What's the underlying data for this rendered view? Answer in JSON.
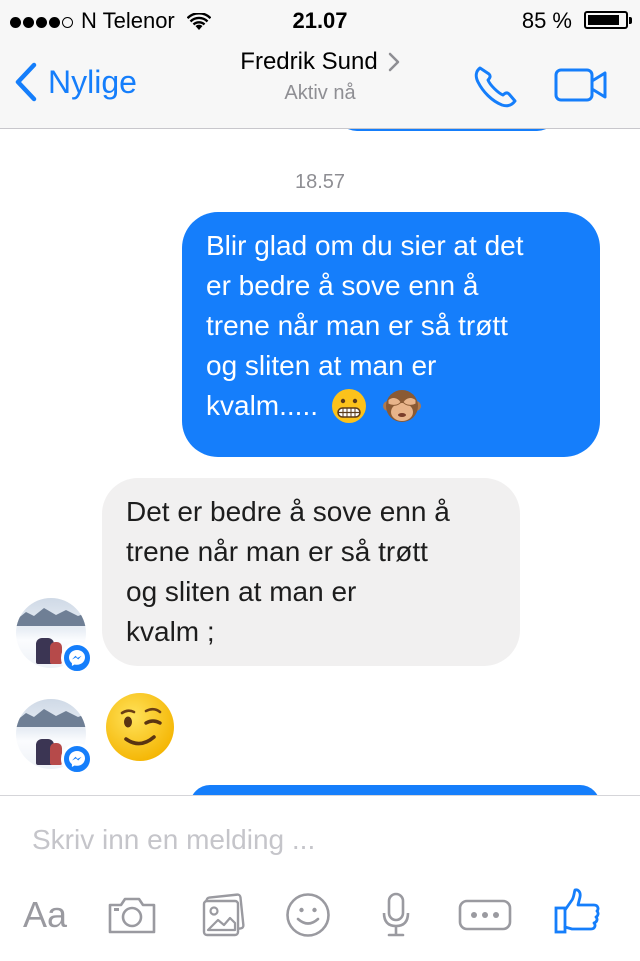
{
  "status_bar": {
    "carrier": "N Telenor",
    "time": "21.07",
    "battery_percent": "85 %",
    "signal_bars": 4,
    "battery_level": 0.85
  },
  "navbar": {
    "back_label": "Nylige",
    "contact_name": "Fredrik Sund",
    "status": "Aktiv nå",
    "back_icon": "chevron-left-icon",
    "phone_icon": "phone-icon",
    "video_icon": "video-camera-icon"
  },
  "conversation": {
    "timestamp": "18.57",
    "messages": [
      {
        "direction": "outgoing",
        "lines": [
          "Blir glad om du sier at det",
          "er bedre å sove enn å",
          "trene når man er så trøtt",
          "og sliten at man er",
          "kvalm....."
        ],
        "emojis": [
          "grimacing-face-emoji",
          "see-no-evil-monkey-emoji"
        ]
      },
      {
        "direction": "incoming",
        "lines": [
          "Det er bedre å sove enn å",
          "trene når man er så trøtt",
          "og sliten at man er",
          "kvalm ;"
        ]
      },
      {
        "direction": "incoming",
        "emoji": "winking-face-emoji"
      }
    ]
  },
  "composer": {
    "placeholder": "Skriv inn en melding ...",
    "tools": {
      "text_label": "Aa",
      "camera_icon": "camera-icon",
      "gallery_icon": "photo-gallery-icon",
      "sticker_icon": "smiley-icon",
      "mic_icon": "microphone-icon",
      "more_icon": "more-icon",
      "like_icon": "thumbs-up-icon"
    }
  },
  "colors": {
    "accent": "#157efb",
    "incoming_bubble": "#f1f0f0",
    "secondary_text": "#8e8e93",
    "toolbar_icons": "#9a9aa0"
  }
}
